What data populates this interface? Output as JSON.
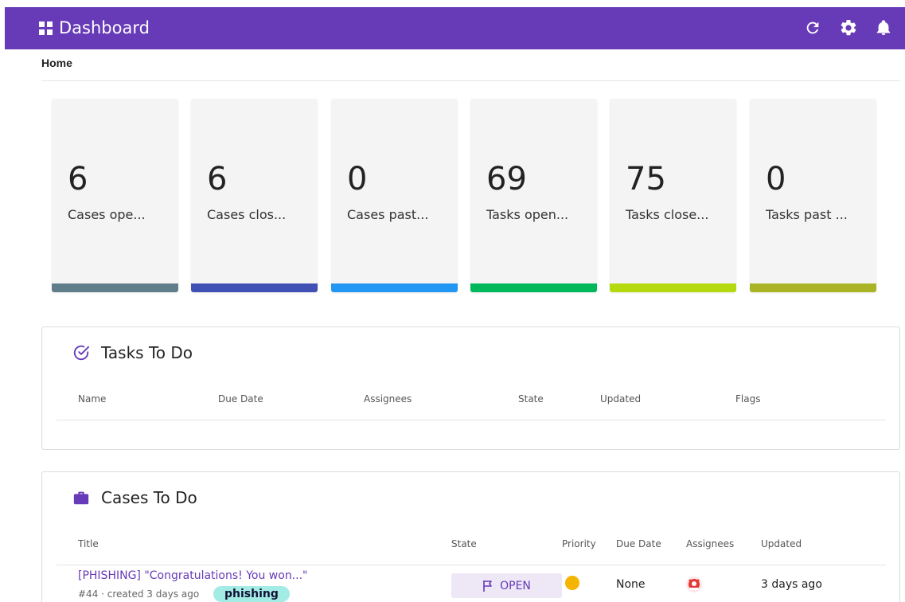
{
  "header": {
    "title": "Dashboard",
    "icons": [
      "dashboard-grid-icon",
      "refresh-icon",
      "gear-icon",
      "bell-icon"
    ],
    "color": "#673ab7"
  },
  "breadcrumb": "Home",
  "stats": [
    {
      "value": "6",
      "label": "Cases ope...",
      "color": "#607d8b"
    },
    {
      "value": "6",
      "label": "Cases clos...",
      "color": "#3f51b5"
    },
    {
      "value": "0",
      "label": "Cases past...",
      "color": "#2196f3"
    },
    {
      "value": "69",
      "label": "Tasks open...",
      "color": "#00b85c"
    },
    {
      "value": "75",
      "label": "Tasks close...",
      "color": "#b4d90f"
    },
    {
      "value": "0",
      "label": "Tasks past ...",
      "color": "#a9b524"
    }
  ],
  "tasks_panel": {
    "title": "Tasks To Do",
    "columns": [
      "Name",
      "Due Date",
      "Assignees",
      "State",
      "Updated",
      "Flags"
    ]
  },
  "cases_panel": {
    "title": "Cases To Do",
    "columns": [
      "Title",
      "State",
      "Priority",
      "Due Date",
      "Assignees",
      "Updated"
    ],
    "rows": [
      {
        "title": "[PHISHING] \"Congratulations! You won...\"",
        "meta": "#44 · created 3 days ago",
        "tag": "phishing",
        "state": "OPEN",
        "priority_color": "#f5b400",
        "due_date": "None",
        "updated": "3 days ago"
      }
    ]
  }
}
